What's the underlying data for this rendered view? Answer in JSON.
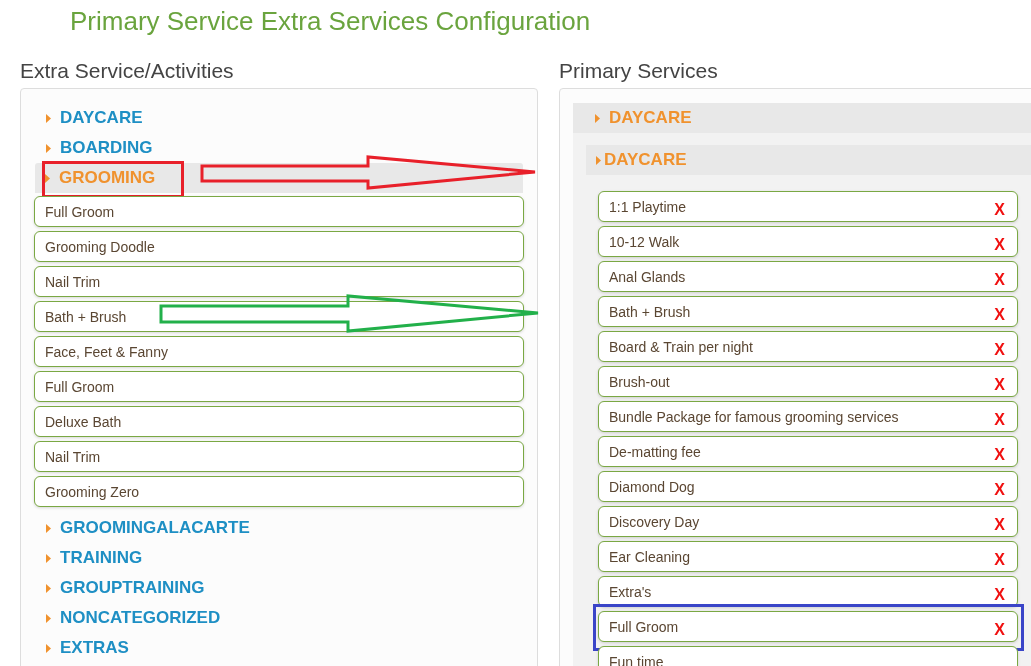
{
  "page_title": "Primary Service Extra Services Configuration",
  "extra_services": {
    "heading": "Extra Service/Activities",
    "categories": [
      {
        "name": "DAYCARE",
        "expanded": false,
        "highlighted": false
      },
      {
        "name": "BOARDING",
        "expanded": false,
        "highlighted": false
      },
      {
        "name": "GROOMING",
        "expanded": true,
        "highlighted": true,
        "items": [
          {
            "label": "Full Groom"
          },
          {
            "label": "Grooming Doodle"
          },
          {
            "label": "Nail Trim"
          },
          {
            "label": "Bath + Brush"
          },
          {
            "label": "Face, Feet & Fanny"
          },
          {
            "label": "Full Groom"
          },
          {
            "label": "Deluxe Bath"
          },
          {
            "label": "Nail Trim"
          },
          {
            "label": "Grooming Zero"
          }
        ]
      },
      {
        "name": "GROOMINGALACARTE",
        "expanded": false,
        "highlighted": false
      },
      {
        "name": "TRAINING",
        "expanded": false,
        "highlighted": false
      },
      {
        "name": "GROUPTRAINING",
        "expanded": false,
        "highlighted": false
      },
      {
        "name": "NONCATEGORIZED",
        "expanded": false,
        "highlighted": false
      },
      {
        "name": "EXTRAS",
        "expanded": false,
        "highlighted": false
      }
    ]
  },
  "primary_services": {
    "heading": "Primary Services",
    "group": {
      "name": "DAYCARE",
      "sub_group": {
        "name": "DAYCARE",
        "items": [
          {
            "label": "1:1 Playtime",
            "remove": "X",
            "highlighted": false
          },
          {
            "label": "10-12 Walk",
            "remove": "X",
            "highlighted": false
          },
          {
            "label": "Anal Glands",
            "remove": "X",
            "highlighted": false
          },
          {
            "label": "Bath + Brush",
            "remove": "X",
            "highlighted": false
          },
          {
            "label": "Board & Train per night",
            "remove": "X",
            "highlighted": false
          },
          {
            "label": "Brush-out",
            "remove": "X",
            "highlighted": false
          },
          {
            "label": "Bundle Package for famous grooming services",
            "remove": "X",
            "highlighted": false
          },
          {
            "label": "De-matting fee",
            "remove": "X",
            "highlighted": false
          },
          {
            "label": "Diamond Dog",
            "remove": "X",
            "highlighted": false
          },
          {
            "label": "Discovery Day",
            "remove": "X",
            "highlighted": false
          },
          {
            "label": "Ear Cleaning",
            "remove": "X",
            "highlighted": false
          },
          {
            "label": "Extra's",
            "remove": "X",
            "highlighted": false
          },
          {
            "label": "Full Groom",
            "remove": "X",
            "highlighted": true
          },
          {
            "label": "Fun time",
            "highlighted": false
          }
        ]
      }
    }
  }
}
